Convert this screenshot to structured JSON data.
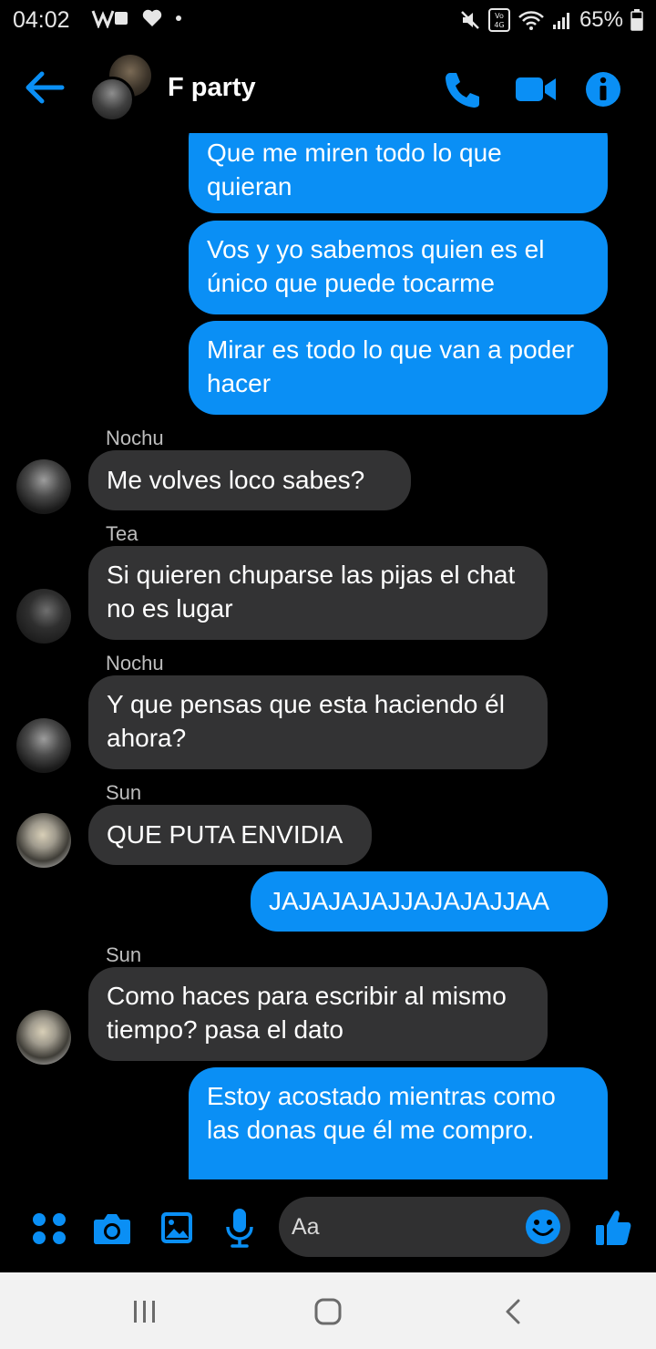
{
  "status_bar": {
    "time": "04:02",
    "battery_percent": "65%",
    "volte_label": "Vo LTE",
    "network_label": "4G"
  },
  "header": {
    "title": "F party"
  },
  "messages": [
    {
      "direction": "out",
      "text": "Que me miren todo lo que quieran"
    },
    {
      "direction": "out",
      "text": "Vos y yo sabemos quien es el único que puede tocarme"
    },
    {
      "direction": "out",
      "text": "Mirar es todo lo que van a poder hacer"
    },
    {
      "direction": "in",
      "sender": "Nochu",
      "text": "Me volves loco sabes?"
    },
    {
      "direction": "in",
      "sender": "Tea",
      "text": "Si quieren chuparse las pijas el chat no es lugar"
    },
    {
      "direction": "in",
      "sender": "Nochu",
      "text": "Y que pensas que esta haciendo él ahora?"
    },
    {
      "direction": "in",
      "sender": "Sun",
      "text": "QUE PUTA ENVIDIA"
    },
    {
      "direction": "out",
      "text": "JAJAJAJAJJAJAJAJJAA"
    },
    {
      "direction": "in",
      "sender": "Sun",
      "text": "Como haces para escribir al mismo tiempo? pasa el dato"
    },
    {
      "direction": "out",
      "text": "Estoy acostado mientras como las donas que él me compro."
    }
  ],
  "composer": {
    "placeholder": "Aa"
  },
  "colors": {
    "accent": "#0a8ff5",
    "incoming_bubble": "#333334",
    "background": "#000000",
    "navbar": "#f2f2f2"
  },
  "icons": [
    "back-arrow-icon",
    "phone-icon",
    "video-camera-icon",
    "info-icon",
    "apps-dots-icon",
    "camera-icon",
    "gallery-icon",
    "microphone-icon",
    "emoji-icon",
    "thumbs-up-icon",
    "recents-icon",
    "home-icon",
    "back-chevron-icon"
  ]
}
